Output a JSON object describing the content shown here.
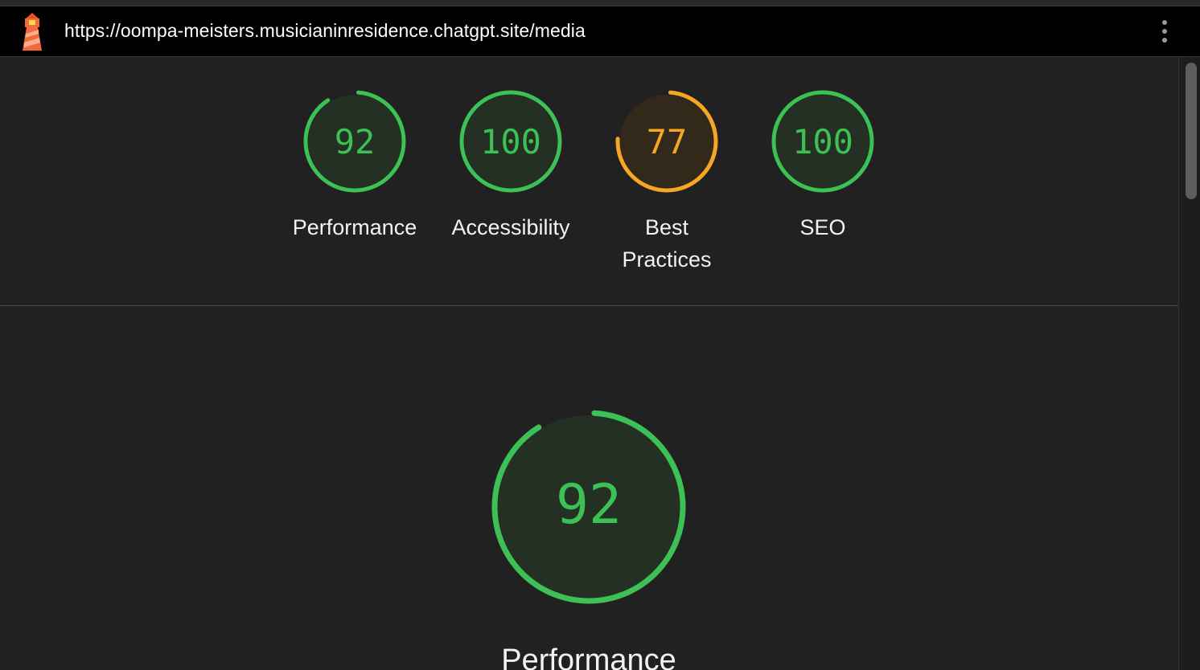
{
  "browser": {
    "url": "https://oompa-meisters.musicianinresidence.chatgpt.site/media",
    "logo_icon": "lighthouse-icon",
    "menu_icon": "vertical-dots-icon"
  },
  "colors": {
    "pass": "#3dc055",
    "average": "#f5a623",
    "background": "#212121"
  },
  "gauges": [
    {
      "label": "Performance",
      "score": "92",
      "value": 0.92,
      "status": "pass"
    },
    {
      "label": "Accessibility",
      "score": "100",
      "value": 1.0,
      "status": "pass"
    },
    {
      "label_line1": "Best",
      "label_line2": "Practices",
      "score": "77",
      "value": 0.77,
      "status": "average"
    },
    {
      "label": "SEO",
      "score": "100",
      "value": 1.0,
      "status": "pass"
    }
  ],
  "main_gauge": {
    "score": "92",
    "value": 0.92,
    "title": "Performance"
  }
}
